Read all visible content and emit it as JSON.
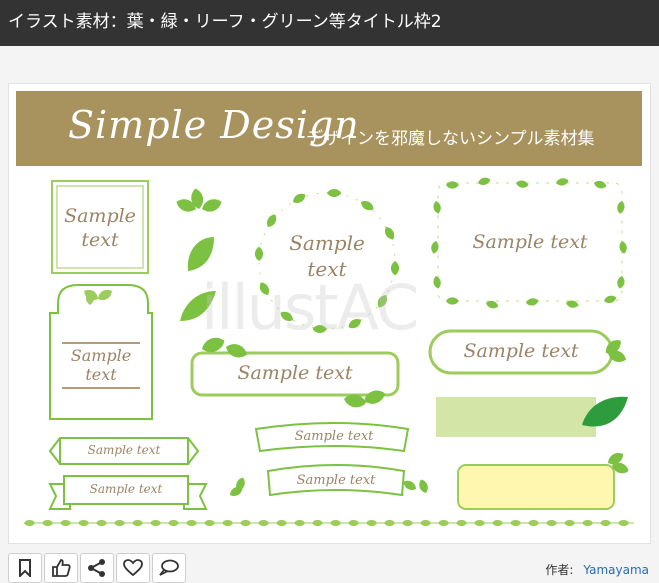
{
  "page": {
    "title": "イラスト素材：葉・緑・リーフ・グリーン等タイトル枠2"
  },
  "artwork": {
    "banner_title": "Simple Design",
    "banner_subtitle": "デザインを邪魔しないシンプル素材集",
    "watermark": "illustAC",
    "samples": {
      "square_frame": [
        "Sample",
        "text"
      ],
      "arch_frame": [
        "Sample",
        "text"
      ],
      "wreath": [
        "Sample",
        "text"
      ],
      "leaf_rect": "Sample text",
      "pill_right": "Sample text",
      "pill_left": "Sample text",
      "ribbon_top_left": "Sample text",
      "ribbon_bottom_left": "Sample text",
      "ribbon_center_top": "Sample text",
      "ribbon_center_bottom": "Sample text"
    }
  },
  "actions": [
    {
      "name": "bookmark-icon",
      "label": "bookmark"
    },
    {
      "name": "thumbs-up-icon",
      "label": "like"
    },
    {
      "name": "share-icon",
      "label": "share"
    },
    {
      "name": "heart-icon",
      "label": "favorite"
    },
    {
      "name": "comment-icon",
      "label": "comment"
    }
  ],
  "author": {
    "label": "作者:",
    "name": "Yamayama"
  },
  "colors": {
    "titlebar": "#333333",
    "banner": "#a8935f",
    "leaf_green": "#7cc142",
    "leaf_dark": "#3f9a2e",
    "sample_text": "#9b8466",
    "author_link": "#2a6ab3"
  }
}
